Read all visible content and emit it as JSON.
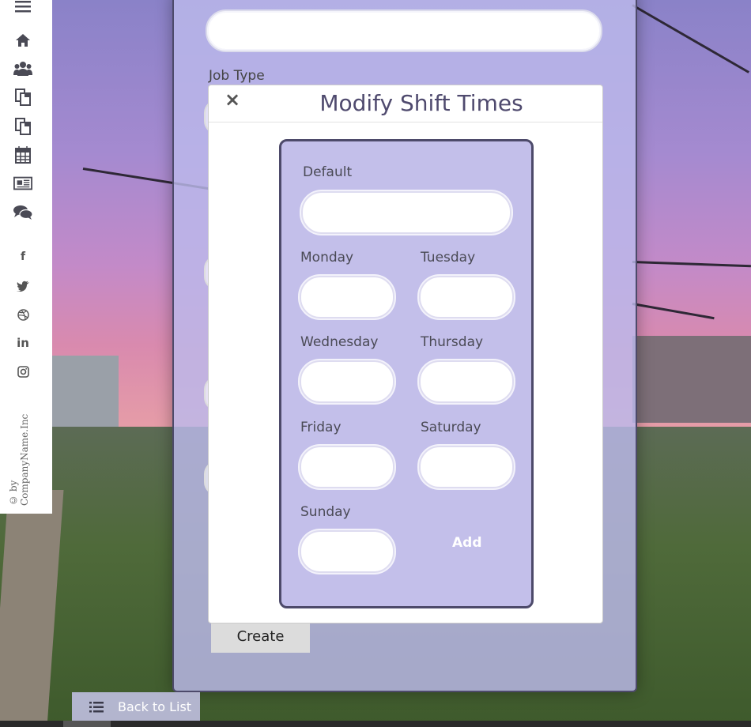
{
  "sidebar": {
    "menu_icon": "hamburger-menu-icon",
    "nav": [
      {
        "icon": "home-icon",
        "glyph": "⌂"
      },
      {
        "icon": "users-icon",
        "glyph": "👥"
      },
      {
        "icon": "documents-icon",
        "glyph": "❐"
      },
      {
        "icon": "copy-icon",
        "glyph": "❐"
      },
      {
        "icon": "calendar-icon",
        "glyph": "▦"
      },
      {
        "icon": "newspaper-icon",
        "glyph": "▤"
      },
      {
        "icon": "chat-icon",
        "glyph": "💬"
      }
    ],
    "social": [
      {
        "icon": "facebook-icon",
        "glyph": "f"
      },
      {
        "icon": "twitter-icon",
        "glyph": "🐦"
      },
      {
        "icon": "dribbble-icon",
        "glyph": "◎"
      },
      {
        "icon": "linkedin-icon",
        "glyph": "in"
      },
      {
        "icon": "instagram-icon",
        "glyph": "◘"
      }
    ],
    "copyright": "© by CompanyName.Inc"
  },
  "form": {
    "job_type_label": "Job Type",
    "create_label": "Create",
    "back_label": "Back to List"
  },
  "modal": {
    "close_glyph": "×",
    "title": "Modify Shift Times",
    "default_label": "Default",
    "default_value": "",
    "days": {
      "monday": "Monday",
      "tuesday": "Tuesday",
      "wednesday": "Wednesday",
      "thursday": "Thursday",
      "friday": "Friday",
      "saturday": "Saturday",
      "sunday": "Sunday"
    },
    "add_label": "Add"
  },
  "colors": {
    "panel": "#bcbaec",
    "card": "#c3bfea",
    "title": "#4f4a6e"
  }
}
